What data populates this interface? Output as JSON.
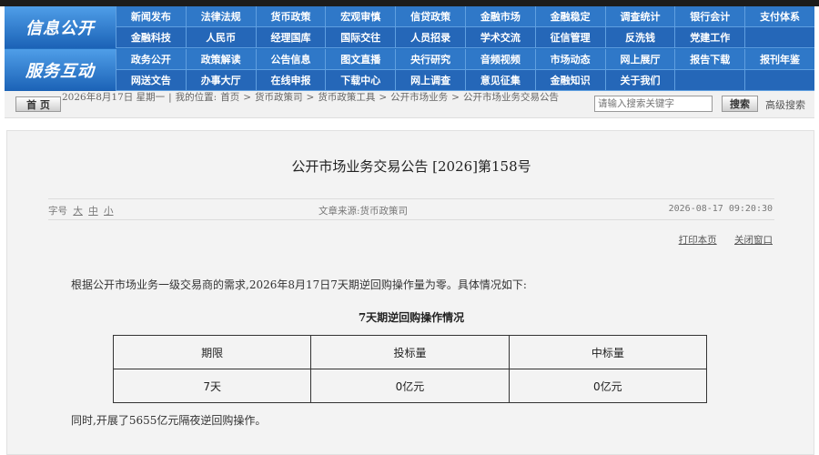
{
  "brand": {
    "left_top": "信息公开",
    "left_bottom": "服务互动"
  },
  "nav": {
    "row1": [
      "新闻发布",
      "法律法规",
      "货币政策",
      "宏观审慎",
      "信贷政策",
      "金融市场",
      "金融稳定",
      "调查统计",
      "银行会计",
      "支付体系"
    ],
    "row2": [
      "金融科技",
      "人民币",
      "经理国库",
      "国际交往",
      "人员招录",
      "学术交流",
      "征信管理",
      "反洗钱",
      "党建工作",
      ""
    ],
    "row3": [
      "政务公开",
      "政策解读",
      "公告信息",
      "图文直播",
      "央行研究",
      "音频视频",
      "市场动态",
      "网上展厅",
      "报告下载",
      "报刊年鉴"
    ],
    "row4": [
      "网送文告",
      "办事大厅",
      "在线申报",
      "下载中心",
      "网上调查",
      "意见征集",
      "金融知识",
      "关于我们",
      "",
      ""
    ]
  },
  "crumbbar": {
    "home_label": "首 页",
    "date": "2026年8月17日 星期一",
    "location_label": "我的位置:",
    "crumbs": [
      "首页",
      ">",
      "货币政策司",
      ">",
      "货币政策工具",
      ">",
      "公开市场业务",
      ">",
      "公开市场业务交易公告"
    ],
    "search_placeholder": "请输入搜索关键字",
    "search_label": "搜索",
    "advanced_label": "高级搜索"
  },
  "article": {
    "title": "公开市场业务交易公告 [2026]第158号",
    "fontsize_label": "字号",
    "fontsize_options": [
      "大",
      "中",
      "小"
    ],
    "source": "文章来源:货币政策司",
    "time": "2026-08-17 09:20:30",
    "print_label": "打印本页",
    "close_label": "关闭窗口",
    "body": "根据公开市场业务一级交易商的需求,2026年8月17日7天期逆回购操作量为零。具体情况如下:",
    "table_title": "7天期逆回购操作情况",
    "table_headers": [
      "期限",
      "投标量",
      "中标量"
    ],
    "table_rows": [
      [
        "7天",
        "0亿元",
        "0亿元"
      ]
    ],
    "note": "同时,开展了5655亿元隔夜逆回购操作。"
  }
}
